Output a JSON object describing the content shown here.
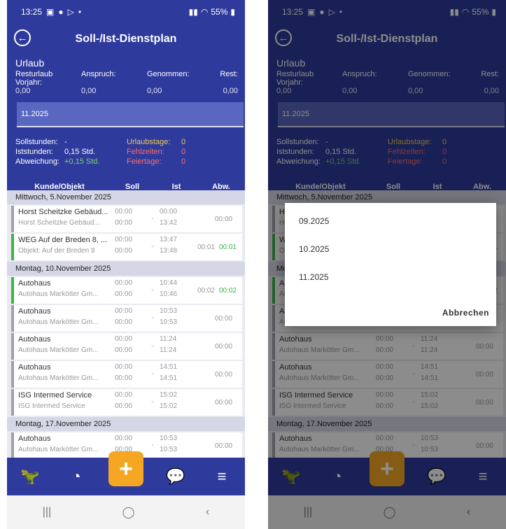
{
  "status": {
    "time": "13:25",
    "battery": "55%"
  },
  "header": {
    "title": "Soll-/Ist-Dienstplan"
  },
  "urlaub": {
    "title": "Urlaub",
    "labels": [
      "Resturlaub Vorjahr:",
      "Anspruch:",
      "Genommen:",
      "Rest:"
    ],
    "values": [
      "0,00",
      "0,00",
      "0,00",
      "0,00"
    ]
  },
  "month": {
    "value": "11.2025"
  },
  "stats": {
    "soll_label": "Sollstunden:",
    "soll_value": "-",
    "ist_label": "Iststunden:",
    "ist_value": "0,15 Std.",
    "abw_label": "Abweichung:",
    "abw_value": "+0,15 Std.",
    "urlaubstage_label": "Urlaubstage:",
    "urlaubstage_value": "0",
    "fehlzeiten_label": "Fehlzeiten:",
    "fehlzeiten_value": "0",
    "feiertage_label": "Feiertage:",
    "feiertage_value": "0"
  },
  "columns": [
    "Kunde/Objekt",
    "Soll",
    "Ist",
    "Abw."
  ],
  "days": [
    {
      "label": "Mittwoch, 5.November 2025",
      "entries": [
        {
          "t1": "Horst Scheitzke Gebäud...",
          "t2": "Horst Scheitzke Gebäud...",
          "s1": "00:00",
          "s2": "00:00",
          "i1": "00:00",
          "i2": "13:42",
          "abw": "00:00",
          "abw2": "",
          "active": false
        },
        {
          "t1": "WEG Auf der Breden 8, ...",
          "t2": "Objekt: Auf der Breden 8",
          "s1": "00:00",
          "s2": "00:00",
          "i1": "13:47",
          "i2": "13:48",
          "abw": "00:01",
          "abw2": "00:01",
          "active": true
        }
      ]
    },
    {
      "label": "Montag, 10.November 2025",
      "entries": [
        {
          "t1": "Autohaus",
          "t2": "Autohaus Markötter Gm...",
          "s1": "00:00",
          "s2": "00:00",
          "i1": "10:44",
          "i2": "10:46",
          "abw": "00:02",
          "abw2": "00:02",
          "active": true
        },
        {
          "t1": "Autohaus",
          "t2": "Autohaus Markötter Gm...",
          "s1": "00:00",
          "s2": "00:00",
          "i1": "10:53",
          "i2": "10:53",
          "abw": "00:00",
          "abw2": "",
          "active": false
        },
        {
          "t1": "Autohaus",
          "t2": "Autohaus Markötter Gm...",
          "s1": "00:00",
          "s2": "00:00",
          "i1": "11:24",
          "i2": "11:24",
          "abw": "00:00",
          "abw2": "",
          "active": false
        },
        {
          "t1": "Autohaus",
          "t2": "Autohaus Markötter Gm...",
          "s1": "00:00",
          "s2": "00:00",
          "i1": "14:51",
          "i2": "14:51",
          "abw": "00:00",
          "abw2": "",
          "active": false
        },
        {
          "t1": "ISG Intermed Service",
          "t2": "ISG Intermed Service",
          "s1": "00:00",
          "s2": "00:00",
          "i1": "15:02",
          "i2": "15:02",
          "abw": "00:00",
          "abw2": "",
          "active": false
        }
      ]
    },
    {
      "label": "Montag, 17.November 2025",
      "entries": [
        {
          "t1": "Autohaus",
          "t2": "Autohaus Markötter Gm...",
          "s1": "00:00",
          "s2": "00:00",
          "i1": "10:53",
          "i2": "10:53",
          "abw": "00:00",
          "abw2": "",
          "active": false
        }
      ]
    }
  ],
  "dialog": {
    "options": [
      "09.2025",
      "10.2025",
      "11.2025"
    ],
    "cancel_label": "Abbrechen"
  },
  "nav": {
    "items": [
      "dino-icon",
      "clock-user-icon",
      "plus-icon",
      "chat-icon",
      "menu-icon"
    ]
  },
  "colors": {
    "primary": "#2f3b9c",
    "accent": "#f5a623",
    "positive": "#3cb44b",
    "warning": "#f2c94c"
  }
}
